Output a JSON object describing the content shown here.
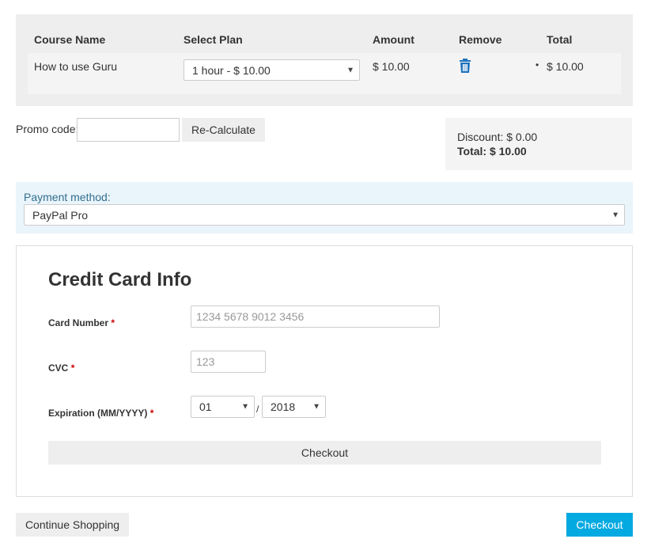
{
  "cart": {
    "columns": [
      "Course Name",
      "Select Plan",
      "Amount",
      "Remove",
      "Total"
    ],
    "rows": [
      {
        "course_name": "How to use Guru",
        "plan_selected": "1 hour - $ 10.00",
        "amount": "$ 10.00",
        "remove_icon": "trash-icon",
        "total": "$ 10.00"
      }
    ]
  },
  "promo": {
    "label": "Promo code:",
    "value": "",
    "placeholder": "",
    "recalculate_label": "Re-Calculate"
  },
  "summary": {
    "discount": "Discount: $ 0.00",
    "total": "Total: $ 10.00"
  },
  "payment": {
    "label": "Payment method:",
    "selected": "PayPal Pro"
  },
  "credit_card": {
    "title": "Credit Card Info",
    "card_number_label": "Card Number",
    "card_number_placeholder": "1234 5678 9012 3456",
    "cvc_label": "CVC",
    "cvc_placeholder": "123",
    "expiration_label": "Expiration (MM/YYYY)",
    "required_marker": "*",
    "exp_month": "01",
    "exp_separator": "/",
    "exp_year": "2018",
    "checkout_label": "Checkout"
  },
  "footer": {
    "continue_label": "Continue Shopping",
    "checkout_label": "Checkout"
  },
  "colors": {
    "accent": "#03a9e1",
    "trash_icon": "#1e73be",
    "required": "#cc0000",
    "payment_bg": "#eaf4fb"
  }
}
